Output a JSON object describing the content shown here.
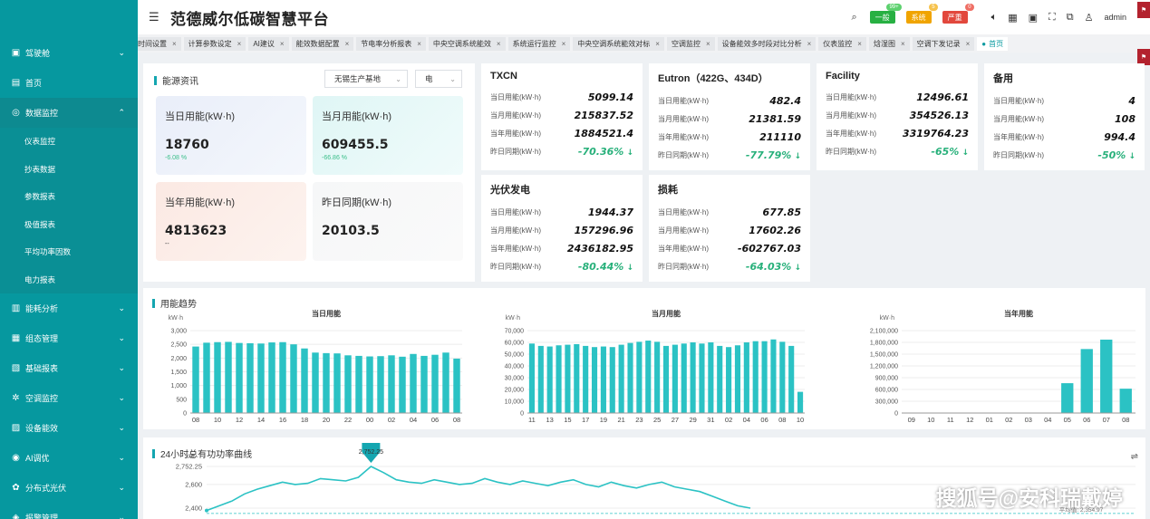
{
  "app": {
    "title": "范德威尔低碳智慧平台",
    "user": "admin"
  },
  "alarms": [
    {
      "label": "一般",
      "count": "99+",
      "bg": "#27b042",
      "cntbg": "#5cd16e"
    },
    {
      "label": "系统",
      "count": "5",
      "bg": "#f0a400",
      "cntbg": "#f6c24c"
    },
    {
      "label": "严重",
      "count": "0",
      "bg": "#e2483d",
      "cntbg": "#ef6f65"
    }
  ],
  "sidebar": {
    "items": [
      {
        "label": "驾驶舱",
        "icon": "dashboard-icon",
        "glyph": "▣",
        "chev": "⌄",
        "type": "group"
      },
      {
        "label": "首页",
        "icon": "home-icon",
        "glyph": "▤",
        "chev": "",
        "type": "group"
      },
      {
        "label": "数据监控",
        "icon": "monitor-icon",
        "glyph": "◎",
        "chev": "⌃",
        "type": "group"
      },
      {
        "label": "仪表监控",
        "type": "sub"
      },
      {
        "label": "抄表数据",
        "type": "sub"
      },
      {
        "label": "参数报表",
        "type": "sub"
      },
      {
        "label": "极值报表",
        "type": "sub"
      },
      {
        "label": "平均功率因数",
        "type": "sub"
      },
      {
        "label": "电力报表",
        "type": "sub"
      },
      {
        "label": "能耗分析",
        "icon": "analysis-icon",
        "glyph": "▥",
        "chev": "⌄",
        "type": "group"
      },
      {
        "label": "组态管理",
        "icon": "config-icon",
        "glyph": "▦",
        "chev": "⌄",
        "type": "group"
      },
      {
        "label": "基础报表",
        "icon": "report-icon",
        "glyph": "▧",
        "chev": "⌄",
        "type": "group"
      },
      {
        "label": "空调监控",
        "icon": "snowflake-icon",
        "glyph": "✲",
        "chev": "⌄",
        "type": "group"
      },
      {
        "label": "设备能效",
        "icon": "device-icon",
        "glyph": "▨",
        "chev": "⌄",
        "type": "group"
      },
      {
        "label": "AI调优",
        "icon": "ai-icon",
        "glyph": "◉",
        "chev": "⌄",
        "type": "group"
      },
      {
        "label": "分布式光伏",
        "icon": "solar-icon",
        "glyph": "✿",
        "chev": "⌄",
        "type": "group"
      },
      {
        "label": "报警管理",
        "icon": "alarm-icon",
        "glyph": "◈",
        "chev": "⌄",
        "type": "group"
      }
    ]
  },
  "tabs": [
    {
      "label": "时间设置",
      "active": false
    },
    {
      "label": "计算参数设定",
      "active": false
    },
    {
      "label": "AI建议",
      "active": false
    },
    {
      "label": "能效数据配置",
      "active": false
    },
    {
      "label": "节电率分析报表",
      "active": false
    },
    {
      "label": "中央空调系统能效",
      "active": false
    },
    {
      "label": "系统运行监控",
      "active": false
    },
    {
      "label": "中央空调系统能效对标",
      "active": false
    },
    {
      "label": "空调监控",
      "active": false
    },
    {
      "label": "设备能效多时段对比分析",
      "active": false
    },
    {
      "label": "仪表监控",
      "active": false
    },
    {
      "label": "焓湿图",
      "active": false
    },
    {
      "label": "空调下发记录",
      "active": false
    },
    {
      "label": "首页",
      "active": true
    }
  ],
  "energy_info": {
    "title": "能源资讯",
    "site_select": "无锡生产基地",
    "type_select": "电",
    "stats": [
      {
        "label": "当日用能(kW·h)",
        "value": "18760",
        "pct": "-6.08 %",
        "bg": "linear-gradient(135deg,#e9eef9,#f4f7fc)"
      },
      {
        "label": "当月用能(kW·h)",
        "value": "609455.5",
        "pct": "-66.86 %",
        "bg": "linear-gradient(135deg,#dff6f5,#f0fbfb)"
      },
      {
        "label": "当年用能(kW·h)",
        "value": "4813623",
        "pct": "--",
        "bg": "linear-gradient(135deg,#fbe9e3,#fdf3ef)"
      },
      {
        "label": "昨日同期(kW·h)",
        "value": "20103.5",
        "pct": "",
        "bg": "linear-gradient(135deg,#f6f7f8,#fafafa)"
      }
    ]
  },
  "meter_cards": [
    {
      "title": "TXCN",
      "rows": [
        {
          "k": "当日用能(kW·h)",
          "v": "5099.14",
          "g": false
        },
        {
          "k": "当月用能(kW·h)",
          "v": "215837.52",
          "g": false
        },
        {
          "k": "当年用能(kW·h)",
          "v": "1884521.4",
          "g": false
        },
        {
          "k": "昨日同期(kW·h)",
          "v": "-70.36%",
          "g": true
        }
      ]
    },
    {
      "title": "Eutron（422G、434D）",
      "rows": [
        {
          "k": "当日用能(kW·h)",
          "v": "482.4",
          "g": false
        },
        {
          "k": "当月用能(kW·h)",
          "v": "21381.59",
          "g": false
        },
        {
          "k": "当年用能(kW·h)",
          "v": "211110",
          "g": false
        },
        {
          "k": "昨日同期(kW·h)",
          "v": "-77.79%",
          "g": true
        }
      ]
    },
    {
      "title": "Facility",
      "rows": [
        {
          "k": "当日用能(kW·h)",
          "v": "12496.61",
          "g": false
        },
        {
          "k": "当月用能(kW·h)",
          "v": "354526.13",
          "g": false
        },
        {
          "k": "当年用能(kW·h)",
          "v": "3319764.23",
          "g": false
        },
        {
          "k": "昨日同期(kW·h)",
          "v": "-65%",
          "g": true
        }
      ]
    },
    {
      "title": "备用",
      "rows": [
        {
          "k": "当日用能(kW·h)",
          "v": "4",
          "g": false
        },
        {
          "k": "当月用能(kW·h)",
          "v": "108",
          "g": false
        },
        {
          "k": "当年用能(kW·h)",
          "v": "994.4",
          "g": false
        },
        {
          "k": "昨日同期(kW·h)",
          "v": "-50%",
          "g": true
        }
      ]
    },
    {
      "title": "光伏发电",
      "rows": [
        {
          "k": "当日用能(kW·h)",
          "v": "1944.37",
          "g": false
        },
        {
          "k": "当月用能(kW·h)",
          "v": "157296.96",
          "g": false
        },
        {
          "k": "当年用能(kW·h)",
          "v": "2436182.95",
          "g": false
        },
        {
          "k": "昨日同期(kW·h)",
          "v": "-80.44%",
          "g": true
        }
      ]
    },
    {
      "title": "损耗",
      "rows": [
        {
          "k": "当日用能(kW·h)",
          "v": "677.85",
          "g": false
        },
        {
          "k": "当月用能(kW·h)",
          "v": "17602.26",
          "g": false
        },
        {
          "k": "当年用能(kW·h)",
          "v": "-602767.03",
          "g": false
        },
        {
          "k": "昨日同期(kW·h)",
          "v": "-64.03%",
          "g": true
        }
      ]
    }
  ],
  "trend": {
    "title": "用能趋势"
  },
  "power_curve": {
    "title": "24小时总有功功率曲线",
    "ylabel": "kW",
    "peak_label": "2,752.25",
    "end_label": "平均值: 2,354.97"
  },
  "watermark": "搜狐号@安科瑞戴婷",
  "chart_data": [
    {
      "type": "bar",
      "title": "当日用能",
      "ylabel": "kW·h",
      "ylim": [
        0,
        3000
      ],
      "yticks": [
        "0",
        "500",
        "1,000",
        "1,500",
        "2,000",
        "2,500",
        "3,000"
      ],
      "categories": [
        "08",
        "09",
        "10",
        "11",
        "12",
        "13",
        "14",
        "15",
        "16",
        "17",
        "18",
        "19",
        "20",
        "21",
        "22",
        "23",
        "00",
        "01",
        "02",
        "03",
        "04",
        "05",
        "06",
        "07",
        "08"
      ],
      "xtick_labels": [
        "08",
        "10",
        "12",
        "14",
        "16",
        "18",
        "20",
        "22",
        "00",
        "02",
        "04",
        "06",
        "08"
      ],
      "values": [
        2420,
        2560,
        2580,
        2590,
        2550,
        2540,
        2530,
        2570,
        2580,
        2500,
        2350,
        2200,
        2180,
        2170,
        2100,
        2080,
        2060,
        2070,
        2100,
        2050,
        2150,
        2080,
        2120,
        2200,
        1980
      ],
      "color": "#2bc2c4"
    },
    {
      "type": "bar",
      "title": "当月用能",
      "ylabel": "kW·h",
      "ylim": [
        0,
        70000
      ],
      "yticks": [
        "0",
        "10,000",
        "20,000",
        "30,000",
        "40,000",
        "50,000",
        "60,000",
        "70,000"
      ],
      "categories": [
        "11",
        "12",
        "13",
        "14",
        "15",
        "16",
        "17",
        "18",
        "19",
        "20",
        "21",
        "22",
        "23",
        "24",
        "25",
        "26",
        "27",
        "28",
        "29",
        "30",
        "31",
        "01",
        "02",
        "03",
        "04",
        "05",
        "06",
        "07",
        "08",
        "09",
        "10"
      ],
      "xtick_labels": [
        "11",
        "13",
        "15",
        "17",
        "19",
        "21",
        "23",
        "25",
        "27",
        "29",
        "31",
        "02",
        "04",
        "06",
        "08",
        "10"
      ],
      "values": [
        59000,
        57000,
        56500,
        57500,
        58000,
        58500,
        57000,
        56000,
        56500,
        56000,
        58000,
        59500,
        60500,
        61500,
        60500,
        57000,
        58000,
        59000,
        60000,
        59000,
        60000,
        57000,
        56000,
        57500,
        60000,
        61000,
        61000,
        62500,
        60500,
        57000,
        18000
      ],
      "color": "#2bc2c4"
    },
    {
      "type": "bar",
      "title": "当年用能",
      "ylabel": "kW·h",
      "ylim": [
        0,
        2100000
      ],
      "yticks": [
        "0",
        "300,000",
        "600,000",
        "900,000",
        "1,200,000",
        "1,500,000",
        "1,800,000",
        "2,100,000"
      ],
      "categories": [
        "09",
        "10",
        "11",
        "12",
        "01",
        "02",
        "03",
        "04",
        "05",
        "06",
        "07",
        "08"
      ],
      "xtick_labels": [
        "09",
        "10",
        "11",
        "12",
        "01",
        "02",
        "03",
        "04",
        "05",
        "06",
        "07",
        "08"
      ],
      "values": [
        0,
        0,
        0,
        0,
        0,
        0,
        0,
        0,
        760000,
        1630000,
        1870000,
        620000
      ],
      "color": "#2bc2c4"
    },
    {
      "type": "line",
      "title": "24小时总有功功率曲线",
      "ylabel": "kW",
      "ylim": [
        2400,
        2752.25
      ],
      "yticks": [
        "2,400",
        "2,600",
        "2,752.25"
      ],
      "values": [
        2380,
        2420,
        2460,
        2520,
        2560,
        2590,
        2620,
        2600,
        2610,
        2650,
        2640,
        2630,
        2660,
        2752,
        2700,
        2640,
        2620,
        2610,
        2640,
        2620,
        2600,
        2610,
        2650,
        2620,
        2600,
        2630,
        2610,
        2590,
        2620,
        2640,
        2600,
        2580,
        2620,
        2590,
        2570,
        2600,
        2620,
        2580,
        2560,
        2540,
        2500,
        2460,
        2420,
        2400
      ],
      "color": "#2bc2c4"
    }
  ]
}
